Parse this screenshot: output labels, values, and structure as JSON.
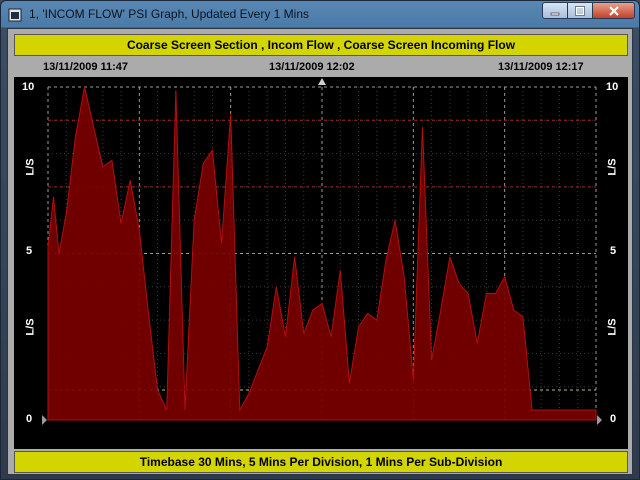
{
  "window": {
    "title": "1, 'INCOM FLOW' PSI Graph, Updated Every 1 Mins"
  },
  "header": {
    "banner": "Coarse Screen Section , Incom Flow , Coarse Screen Incoming Flow"
  },
  "footer": {
    "banner": "Timebase 30 Mins,  5 Mins Per Division,  1 Mins Per Sub-Division"
  },
  "time_labels": {
    "start": "13/11/2009  11:47",
    "mid": "13/11/2009  12:02",
    "end": "13/11/2009  12:17"
  },
  "axis": {
    "y_top": "10",
    "y_mid": "5",
    "y_bottom": "0",
    "unit": "L/S"
  },
  "colors": {
    "fill": "#7a0000",
    "grid_yellow": "#b8b880",
    "grid_red": "#b02020",
    "banner_bg": "#d4d400"
  },
  "chart_data": {
    "type": "area",
    "xlabel": "",
    "ylabel": "L/S",
    "ylim": [
      0,
      10
    ],
    "x_range_minutes": [
      0,
      30
    ],
    "alarm_levels": [
      0.9,
      7.0,
      9.0
    ],
    "series": [
      {
        "x": [
          0,
          0.3,
          0.6,
          1.0,
          1.5,
          2.0,
          2.5,
          3.0,
          3.5,
          4.0,
          4.5,
          5.0,
          5.5,
          6.0,
          6.5,
          7.0,
          7.5,
          8.0,
          8.5,
          9.0,
          9.5,
          10.0,
          10.5,
          11.0,
          11.5,
          12.0,
          12.5,
          13.0,
          13.5,
          14.0,
          14.5,
          15.0,
          15.5,
          16.0,
          16.5,
          17.0,
          17.5,
          18.0,
          18.5,
          19.0,
          19.5,
          20.0,
          20.5,
          21.0,
          21.5,
          22.0,
          22.5,
          23.0,
          23.5,
          24.0,
          24.5,
          25.0,
          25.5,
          26.0,
          26.5,
          27.0,
          27.5,
          28.0,
          28.5,
          29.0,
          29.5,
          30.0
        ],
        "values": [
          5.2,
          6.7,
          5.0,
          6.2,
          8.5,
          10.0,
          8.8,
          7.6,
          7.8,
          5.9,
          7.2,
          5.7,
          3.2,
          0.9,
          0.3,
          9.9,
          0.3,
          6.0,
          7.7,
          8.1,
          5.3,
          9.2,
          0.3,
          0.8,
          1.5,
          2.2,
          4.0,
          2.5,
          4.9,
          2.6,
          3.3,
          3.5,
          2.5,
          4.5,
          1.1,
          2.8,
          3.2,
          3.0,
          4.8,
          6.0,
          4.3,
          1.2,
          8.8,
          1.8,
          3.3,
          4.9,
          4.1,
          3.8,
          2.3,
          3.8,
          3.8,
          4.3,
          3.3,
          3.1,
          0.3,
          0.3,
          0.3,
          0.3,
          0.3,
          0.3,
          0.3,
          0.3
        ]
      }
    ]
  }
}
